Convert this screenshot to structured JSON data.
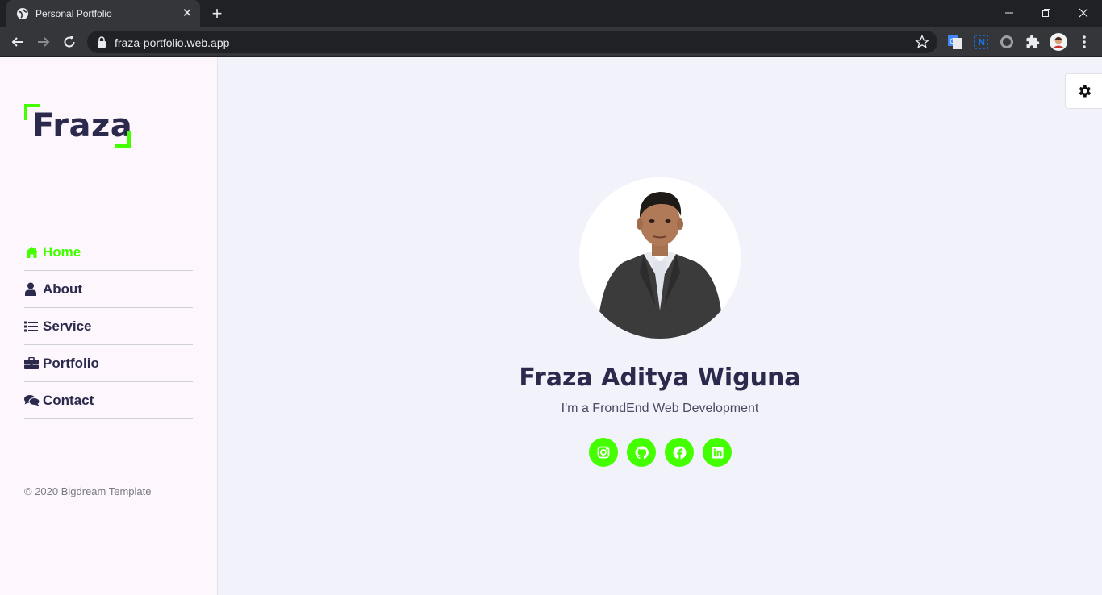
{
  "browser": {
    "tab_title": "Personal Portfolio",
    "url": "fraza-portfolio.web.app"
  },
  "sidebar": {
    "logo_text": "Fraza",
    "menu": [
      {
        "label": "Home",
        "icon": "home-icon",
        "active": true
      },
      {
        "label": "About",
        "icon": "user-icon",
        "active": false
      },
      {
        "label": "Service",
        "icon": "list-icon",
        "active": false
      },
      {
        "label": "Portfolio",
        "icon": "briefcase-icon",
        "active": false
      },
      {
        "label": "Contact",
        "icon": "comments-icon",
        "active": false
      }
    ],
    "copyright": "© 2020 Bigdream Template"
  },
  "hero": {
    "name": "Fraza Aditya Wiguna",
    "tagline": "I'm a FrondEnd Web Development",
    "socials": [
      "instagram-icon",
      "github-icon",
      "facebook-icon",
      "linkedin-icon"
    ]
  },
  "colors": {
    "accent": "#44ff00",
    "text_dark": "#2b2a4c",
    "sidebar_bg": "#fdf7fd",
    "main_bg": "#f2f2fb"
  }
}
